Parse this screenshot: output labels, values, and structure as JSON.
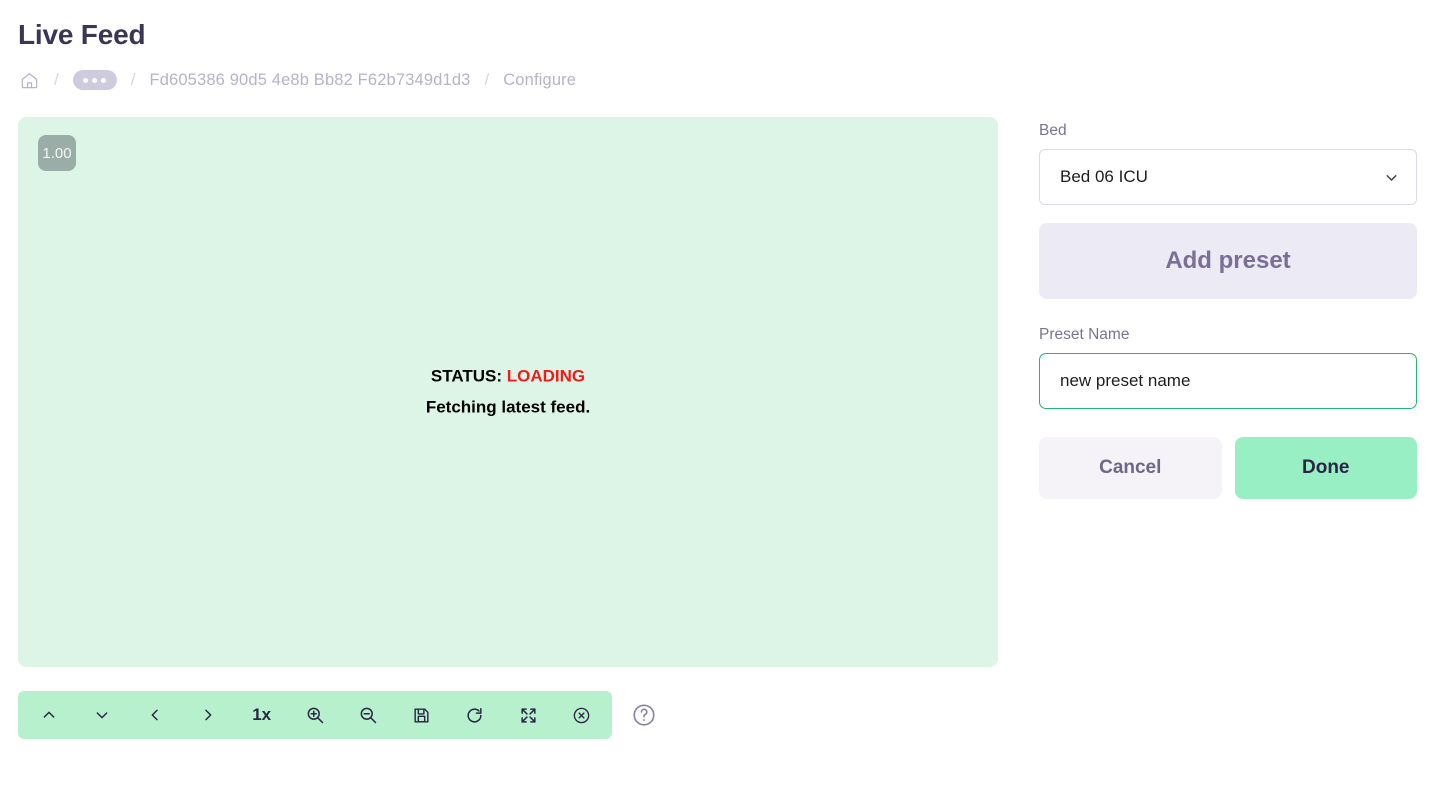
{
  "header": {
    "title": "Live Feed",
    "breadcrumb": {
      "home_icon": "home-icon",
      "separator": "/",
      "ellipsis_icon": "ellipsis-pill",
      "items": [
        {
          "label": "Fd605386 90d5 4e8b Bb82 F62b7349d1d3"
        },
        {
          "label": "Configure"
        }
      ]
    }
  },
  "viewer": {
    "scale_badge": "1.00",
    "status_label": "STATUS:",
    "status_value": "LOADING",
    "status_message": "Fetching latest feed.",
    "background_color": "#dcf5e7",
    "status_value_color": "#ee1c1c"
  },
  "toolbar": {
    "background_color": "#b7f0cd",
    "zoom_level": "1x",
    "buttons": [
      {
        "name": "chevron-up-icon",
        "title": "Pan up"
      },
      {
        "name": "chevron-down-icon",
        "title": "Pan down"
      },
      {
        "name": "chevron-left-icon",
        "title": "Previous"
      },
      {
        "name": "chevron-right-icon",
        "title": "Next"
      },
      {
        "name": "zoom-in-icon",
        "title": "Zoom in"
      },
      {
        "name": "zoom-out-icon",
        "title": "Zoom out"
      },
      {
        "name": "save-icon",
        "title": "Save"
      },
      {
        "name": "refresh-icon",
        "title": "Refresh"
      },
      {
        "name": "fullscreen-icon",
        "title": "Fullscreen"
      },
      {
        "name": "close-circle-icon",
        "title": "Close"
      }
    ],
    "help_icon": "help-circle-icon"
  },
  "sidebar": {
    "bed_label": "Bed",
    "bed_value": "Bed 06 ICU",
    "bed_options": [
      "Bed 06 ICU"
    ],
    "add_preset_label": "Add preset",
    "preset_name_label": "Preset Name",
    "preset_name_value": "new preset name",
    "preset_name_placeholder": "new preset name",
    "cancel_label": "Cancel",
    "done_label": "Done",
    "done_color": "#99efc4",
    "add_preset_color": "#eceaf5"
  }
}
